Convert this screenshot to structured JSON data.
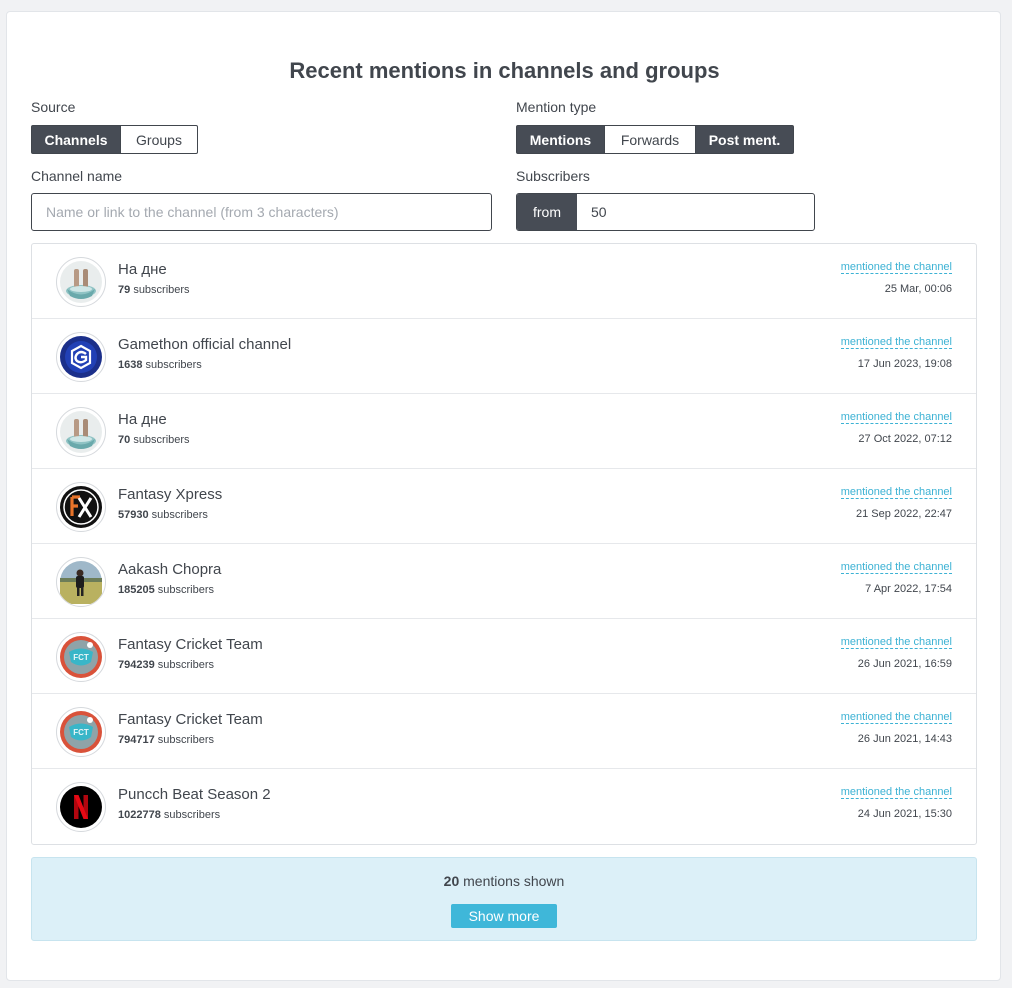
{
  "page_title": "Recent mentions in channels and groups",
  "source": {
    "label": "Source",
    "options": [
      "Channels",
      "Groups"
    ],
    "active": 0
  },
  "mention_type": {
    "label": "Mention type",
    "options": [
      "Mentions",
      "Forwards",
      "Post ment."
    ],
    "active": [
      0,
      2
    ]
  },
  "channel_name": {
    "label": "Channel name",
    "placeholder": "Name or link to the channel (from 3 characters)",
    "value": ""
  },
  "subscribers": {
    "label": "Subscribers",
    "prefix": "from",
    "value": "50"
  },
  "mentions": [
    {
      "name": "На дне",
      "count": "79",
      "suffix": "subscribers",
      "mention": "mentioned the channel",
      "date": "25 Mar, 00:06",
      "avatar": "bucket-feet-icon"
    },
    {
      "name": "Gamethon official channel",
      "count": "1638",
      "suffix": "subscribers",
      "mention": "mentioned the channel",
      "date": "17 Jun 2023, 19:08",
      "avatar": "gamethon-logo-icon"
    },
    {
      "name": "На дне",
      "count": "70",
      "suffix": "subscribers",
      "mention": "mentioned the channel",
      "date": "27 Oct 2022, 07:12",
      "avatar": "bucket-feet-icon"
    },
    {
      "name": "Fantasy Xpress",
      "count": "57930",
      "suffix": "subscribers",
      "mention": "mentioned the channel",
      "date": "21 Sep 2022, 22:47",
      "avatar": "fx-logo-icon"
    },
    {
      "name": "Aakash Chopra",
      "count": "185205",
      "suffix": "subscribers",
      "mention": "mentioned the channel",
      "date": "7 Apr 2022, 17:54",
      "avatar": "person-photo-icon"
    },
    {
      "name": "Fantasy Cricket Team",
      "count": "794239",
      "suffix": "subscribers",
      "mention": "mentioned the channel",
      "date": "26 Jun 2021, 16:59",
      "avatar": "fct-logo-icon"
    },
    {
      "name": "Fantasy Cricket Team",
      "count": "794717",
      "suffix": "subscribers",
      "mention": "mentioned the channel",
      "date": "26 Jun 2021, 14:43",
      "avatar": "fct-logo-icon"
    },
    {
      "name": "Puncch Beat Season 2",
      "count": "1022778",
      "suffix": "subscribers",
      "mention": "mentioned the channel",
      "date": "24 Jun 2021, 15:30",
      "avatar": "netflix-logo-icon"
    }
  ],
  "footer": {
    "count": "20",
    "text": "mentions shown",
    "button": "Show more"
  },
  "colors": {
    "accent": "#3cb2d4",
    "dark": "#474c55",
    "footer_bg": "#dcf0f8"
  }
}
